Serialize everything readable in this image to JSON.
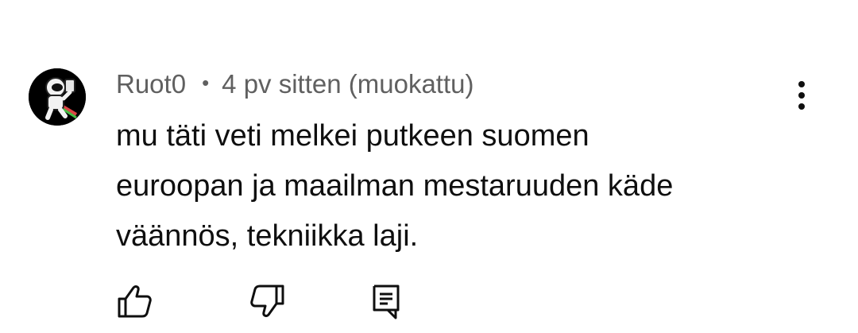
{
  "comment": {
    "author": "Ruot0",
    "separator": "•",
    "timestamp": "4 pv sitten (muokattu)",
    "text": "mu täti veti melkei putkeen suomen\neuroopan ja maailman mestaruuden käde\nväännös, tekniikka laji.",
    "avatar_icon": "astronaut-avatar-icon"
  },
  "actions": {
    "like_icon": "thumbs-up-icon",
    "dislike_icon": "thumbs-down-icon",
    "reply_icon": "comment-reply-icon",
    "menu_icon": "more-vertical-icon"
  }
}
